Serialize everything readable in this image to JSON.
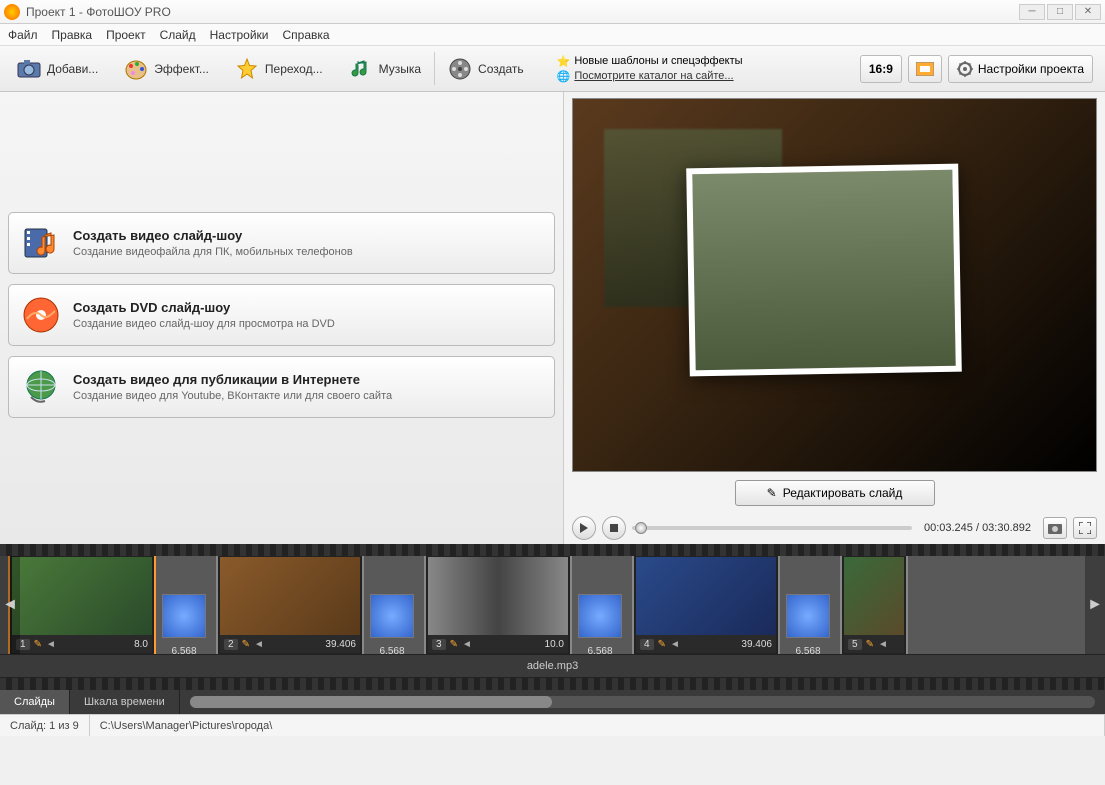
{
  "window": {
    "title": "Проект 1 - ФотоШОУ PRO"
  },
  "menu": [
    "Файл",
    "Правка",
    "Проект",
    "Слайд",
    "Настройки",
    "Справка"
  ],
  "tabs": {
    "add": "Добави...",
    "effects": "Эффект...",
    "transitions": "Переход...",
    "music": "Музыка",
    "create": "Создать"
  },
  "promo": {
    "line1": "Новые шаблоны и спецэффекты",
    "line2": "Посмотрите каталог на сайте..."
  },
  "aspect": "16:9",
  "settings_btn": "Настройки проекта",
  "actions": [
    {
      "title": "Создать видео слайд-шоу",
      "sub": "Создание видеофайла для ПК, мобильных телефонов"
    },
    {
      "title": "Создать DVD слайд-шоу",
      "sub": "Создание видео слайд-шоу для просмотра на DVD"
    },
    {
      "title": "Создать видео для публикации в Интернете",
      "sub": "Создание видео для Youtube, ВКонтакте или для своего сайта"
    }
  ],
  "edit_slide": "Редактировать слайд",
  "playback": {
    "current": "00:03.245",
    "total": "03:30.892"
  },
  "timeline": {
    "slides": [
      {
        "num": "1",
        "dur": "8.0"
      },
      {
        "num": "2",
        "dur": "39.406"
      },
      {
        "num": "3",
        "dur": "10.0"
      },
      {
        "num": "4",
        "dur": "39.406"
      },
      {
        "num": "5",
        "dur": ""
      }
    ],
    "transition_dur": "6.568",
    "audio": "adele.mp3"
  },
  "bottom_tabs": {
    "slides": "Слайды",
    "timeline": "Шкала времени"
  },
  "status": {
    "slide": "Слайд: 1 из 9",
    "path": "C:\\Users\\Manager\\Pictures\\города\\"
  }
}
